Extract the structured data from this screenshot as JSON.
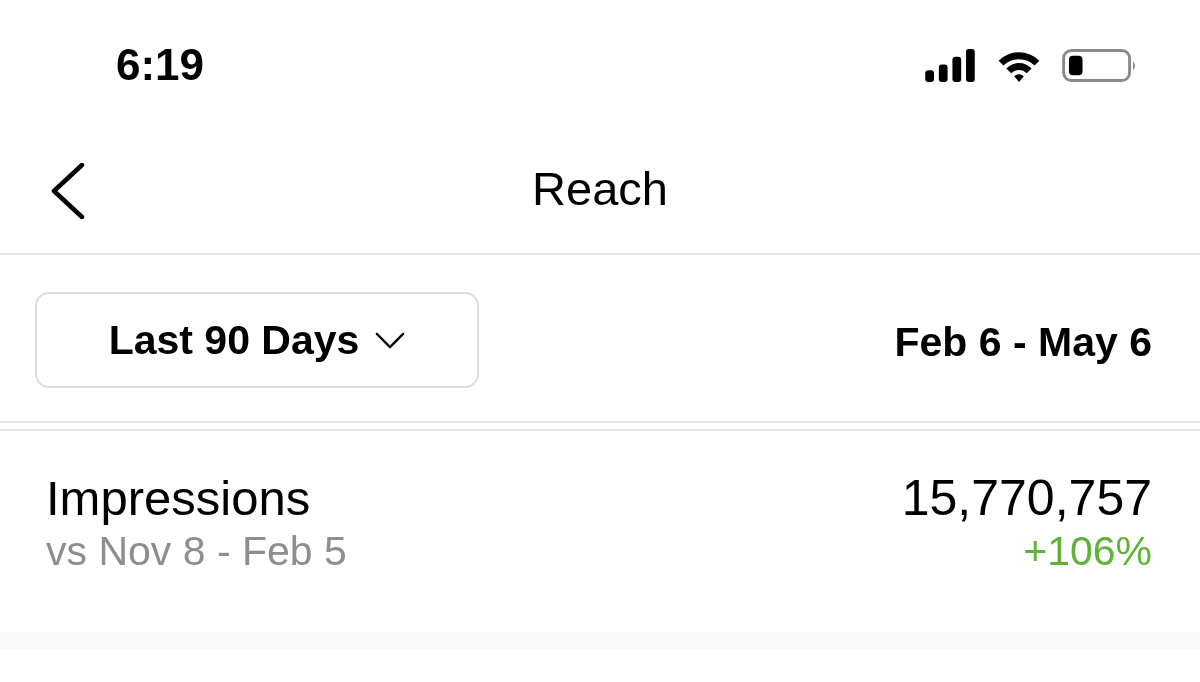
{
  "status_bar": {
    "time": "6:19"
  },
  "nav_bar": {
    "title": "Reach"
  },
  "filter": {
    "period": "Last 90 Days",
    "date_range": "Feb 6 - May 6"
  },
  "metric": {
    "name": "Impressions",
    "comparison": "vs Nov 8 - Feb 5",
    "value": "15,770,757",
    "change": "+106%",
    "positive": true
  }
}
